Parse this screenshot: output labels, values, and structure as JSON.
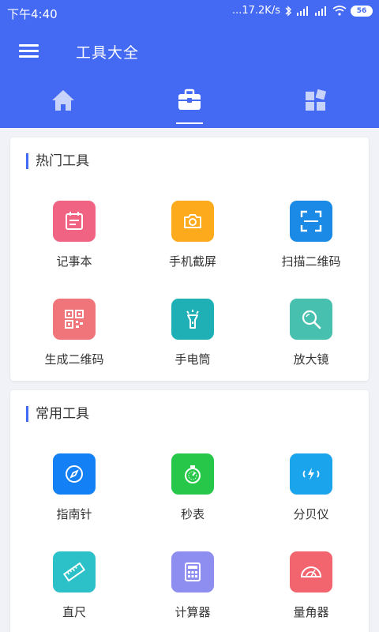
{
  "status_bar": {
    "time": "下午4:40",
    "speed": "...17.2K/s",
    "battery": "56"
  },
  "header": {
    "title": "工具大全"
  },
  "tabs": [
    {
      "icon": "home-icon",
      "selected": false
    },
    {
      "icon": "toolbox-icon",
      "selected": true
    },
    {
      "icon": "apps-grid-icon",
      "selected": false
    }
  ],
  "sections": [
    {
      "title": "热门工具",
      "tools": [
        {
          "label": "记事本",
          "icon": "notepad-icon",
          "color": "#f06383"
        },
        {
          "label": "手机截屏",
          "icon": "camera-icon",
          "color": "#fdaa1c"
        },
        {
          "label": "扫描二维码",
          "icon": "scan-icon",
          "color": "#1a8ae6"
        },
        {
          "label": "生成二维码",
          "icon": "qrcode-icon",
          "color": "#f0757a"
        },
        {
          "label": "手电筒",
          "icon": "flashlight-icon",
          "color": "#1fb0b6"
        },
        {
          "label": "放大镜",
          "icon": "magnifier-icon",
          "color": "#48c0b0"
        }
      ]
    },
    {
      "title": "常用工具",
      "tools": [
        {
          "label": "指南针",
          "icon": "compass-icon",
          "color": "#1480f5"
        },
        {
          "label": "秒表",
          "icon": "stopwatch-icon",
          "color": "#27c84a"
        },
        {
          "label": "分贝仪",
          "icon": "decibel-icon",
          "color": "#1aa4ec"
        },
        {
          "label": "直尺",
          "icon": "ruler-icon",
          "color": "#2cc1c8"
        },
        {
          "label": "计算器",
          "icon": "calculator-icon",
          "color": "#8e8ef0"
        },
        {
          "label": "量角器",
          "icon": "protractor-icon",
          "color": "#f2646e"
        }
      ]
    }
  ]
}
